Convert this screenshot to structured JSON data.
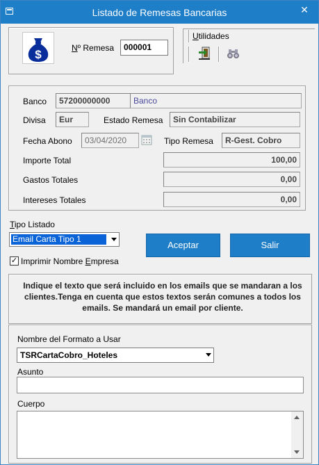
{
  "window": {
    "title": "Listado de Remesas Bancarias",
    "close_glyph": "✕"
  },
  "header": {
    "remesa_label_prefix": "",
    "remesa_label_underlined": "N",
    "remesa_label_rest": "º Remesa",
    "remesa_value": "000001",
    "utilidades_underlined": "U",
    "utilidades_rest": "tilidades"
  },
  "info": {
    "banco_label": "Banco",
    "banco_code": "57200000000",
    "banco_name": "Banco",
    "divisa_label": "Divisa",
    "divisa_value": "Eur",
    "estado_label": "Estado Remesa",
    "estado_value": "Sin Contabilizar",
    "fecha_label": "Fecha Abono",
    "fecha_value": "03/04/2020",
    "tipo_label": "Tipo Remesa",
    "tipo_value": "R-Gest. Cobro",
    "importe_label": "Importe Total",
    "importe_value": "100,00",
    "gastos_label": "Gastos Totales",
    "gastos_value": "0,00",
    "intereses_label": "Intereses Totales",
    "intereses_value": "0,00"
  },
  "listado": {
    "tipo_label_underlined": "T",
    "tipo_label_rest": "ipo Listado",
    "tipo_value": "Email Carta Tipo 1",
    "imprimir_label_a": "Imprimir Nombre ",
    "imprimir_label_underlined": "E",
    "imprimir_label_b": "mpresa",
    "imprimir_checked": "✓",
    "aceptar_label": "Aceptar",
    "salir_label": "Salir"
  },
  "notice": {
    "text": "Indique el texto que será incluido en los emails que se mandaran a los clientes.Tenga en cuenta que estos textos serán comunes a todos los emails. Se mandará un email por cliente."
  },
  "email": {
    "formato_label": "Nombre del Formato a Usar",
    "formato_value": "TSRCartaCobro_Hoteles",
    "asunto_label": "Asunto",
    "asunto_value": "",
    "cuerpo_label": "Cuerpo",
    "cuerpo_value": ""
  },
  "colors": {
    "accent": "#1e7ec8",
    "selection": "#0a64d8"
  },
  "icons": [
    "money-bag-icon",
    "exit-door-icon",
    "binoculars-icon",
    "calendar-icon",
    "close-icon",
    "chevron-down-icon"
  ]
}
